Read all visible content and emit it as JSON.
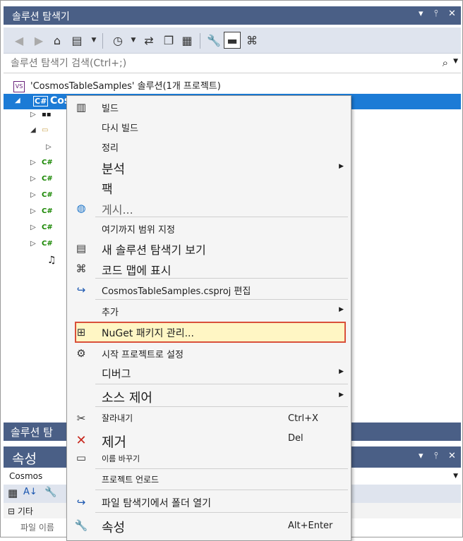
{
  "window": {
    "title": "솔루션 탐색기",
    "controls": [
      "▾",
      "📌",
      "✕"
    ]
  },
  "search": {
    "placeholder": "솔루션 탐색기 검색(Ctrl+;)"
  },
  "tree": {
    "solution_label": "'CosmosTableSamples' 솔루션(1개 프로젝트)",
    "selected_project": "Cosmos"
  },
  "bottom_tab": {
    "label": "솔루션 탐"
  },
  "properties": {
    "title": "속성",
    "object": "Cosmos",
    "category": "⊟ 기타",
    "row_label": "파일 이름"
  },
  "context_menu": {
    "items": [
      {
        "label": "빌드",
        "icon": "build-icon"
      },
      {
        "label": "다시 빌드"
      },
      {
        "label": "정리"
      },
      {
        "label": "분석",
        "submenu": true
      },
      {
        "label": "팩"
      },
      {
        "label": "게시...",
        "icon": "globe-publish-icon"
      },
      {
        "label": "여기까지 범위 지정"
      },
      {
        "label": "새 솔루션 탐색기 보기",
        "icon": "new-view-icon"
      },
      {
        "label": "코드 맵에 표시",
        "icon": "code-map-icon"
      },
      {
        "label": "CosmosTableSamples.csproj 편집",
        "icon": "edit-project-icon"
      },
      {
        "label": "추가",
        "submenu": true
      },
      {
        "label": "NuGet 패키지 관리...",
        "icon": "nuget-icon",
        "highlighted": true
      },
      {
        "label": "시작 프로젝트로 설정",
        "icon": "gear-icon"
      },
      {
        "label": "디버그",
        "submenu": true
      },
      {
        "label": "소스 제어",
        "submenu": true
      },
      {
        "label": "잘라내기",
        "icon": "cut-icon",
        "shortcut": "Ctrl+X"
      },
      {
        "label": "제거",
        "icon": "remove-icon",
        "shortcut": "Del"
      },
      {
        "label": "이름 바꾸기",
        "icon": "rename-icon"
      },
      {
        "label": "프로젝트 언로드"
      },
      {
        "label": "파일 탐색기에서 폴더 열기",
        "icon": "open-folder-icon"
      },
      {
        "label": "속성",
        "icon": "wrench-icon",
        "shortcut": "Alt+Enter"
      }
    ]
  },
  "colors": {
    "title_bar": "#4a5f86",
    "selection": "#1c7bd6",
    "highlight_border": "#d9503a",
    "highlight_fill": "#fff6c4"
  }
}
